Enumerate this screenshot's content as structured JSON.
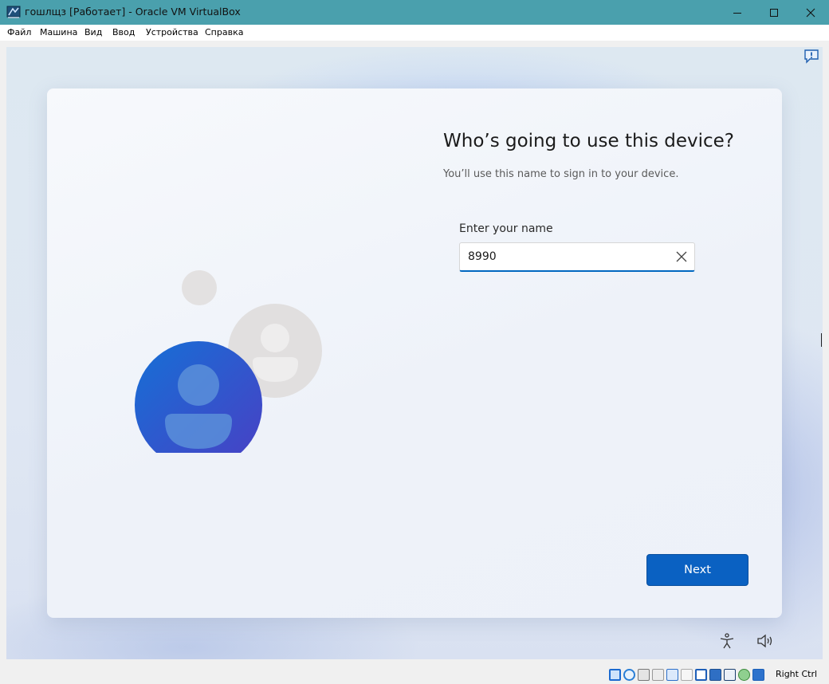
{
  "window": {
    "title": "гошлщз [Работает] - Oracle VM VirtualBox"
  },
  "menu": [
    "Файл",
    "Машина",
    "Вид",
    "Ввод",
    "Устройства",
    "Справка"
  ],
  "oobe": {
    "heading": "Who’s going to use this device?",
    "subheading": "You’ll use this name to sign in to your device.",
    "field_label": "Enter your name",
    "name_value": "8990",
    "next_label": "Next"
  },
  "icons": {
    "feedback": "feedback-icon",
    "accessibility": "accessibility-icon",
    "volume": "volume-icon",
    "clear": "close-icon"
  },
  "statusbar": {
    "host_key": "Right Ctrl"
  },
  "colors": {
    "titlebar": "#4aa0ad",
    "accent": "#0a61c2"
  }
}
